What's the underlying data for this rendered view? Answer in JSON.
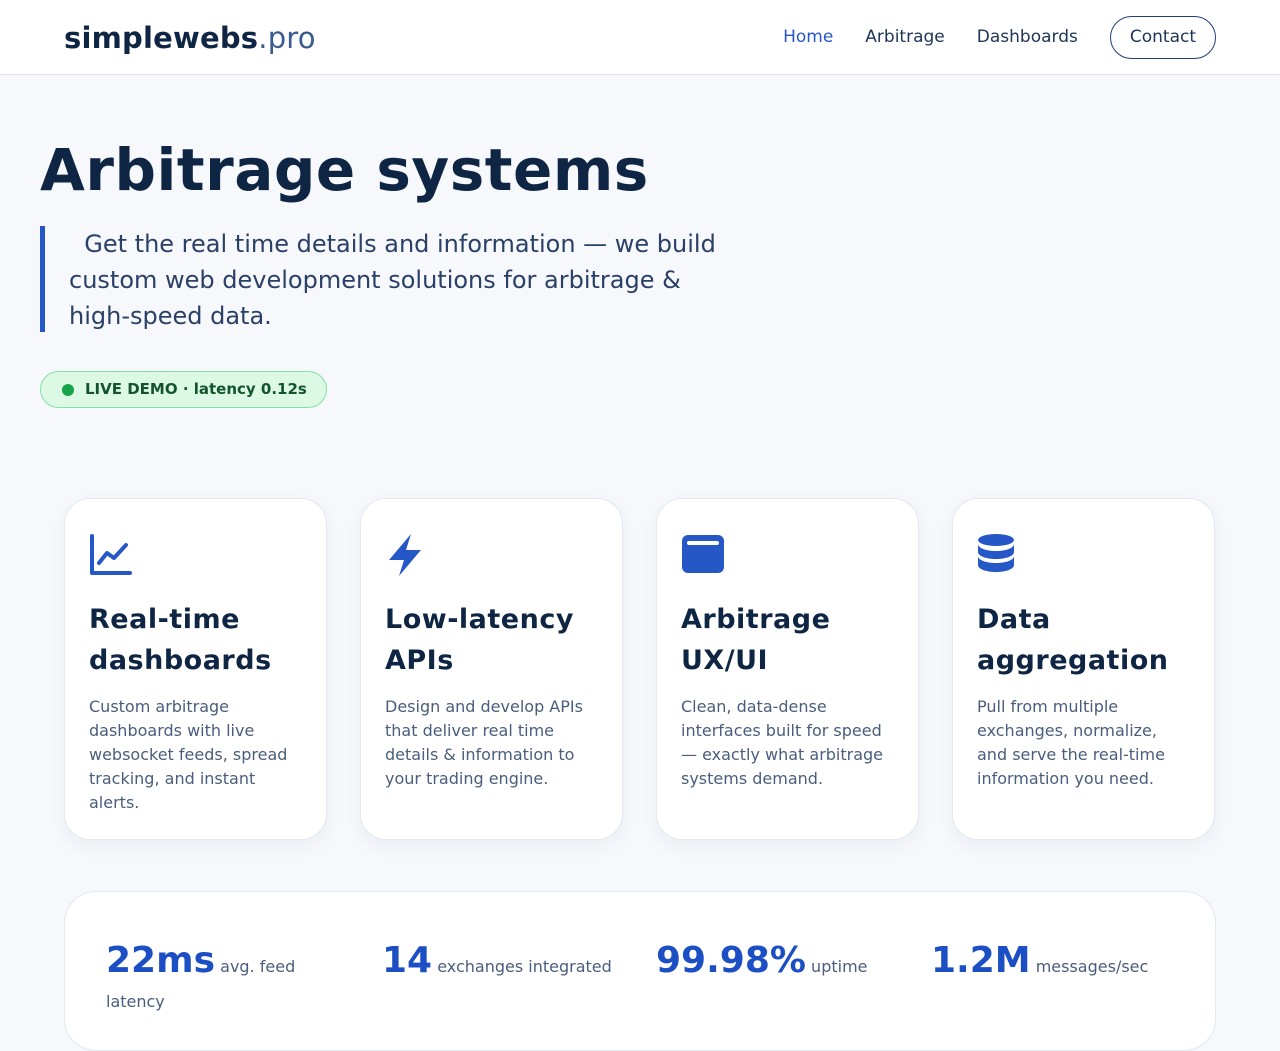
{
  "header": {
    "logo_bold": "simplewebs",
    "logo_light": ".pro",
    "nav": [
      "Home",
      "Arbitrage",
      "Dashboards"
    ],
    "contact_label": "Contact"
  },
  "hero": {
    "title": "Arbitrage systems",
    "quote": "Get the real time details and information — we build custom web development solutions for arbitrage & high-speed data.",
    "badge": "LIVE DEMO · latency 0.12s"
  },
  "cards": [
    {
      "icon": "line-chart-icon",
      "title": "Real-time dashboards",
      "text": "Custom arbitrage dashboards with live websocket feeds, spread tracking, and instant alerts."
    },
    {
      "icon": "lightning-icon",
      "title": "Low-latency APIs",
      "text": "Design and develop APIs that deliver real time details & information to your trading engine."
    },
    {
      "icon": "window-icon",
      "title": "Arbitrage UX/UI",
      "text": "Clean, data-dense interfaces built for speed — exactly what arbitrage systems demand."
    },
    {
      "icon": "database-icon",
      "title": "Data aggregation",
      "text": "Pull from multiple exchanges, normalize, and serve the real-time information you need."
    }
  ],
  "stats": [
    {
      "value": "22ms",
      "label": "avg. feed latency"
    },
    {
      "value": "14",
      "label": "exchanges integrated"
    },
    {
      "value": "99.98%",
      "label": "uptime"
    },
    {
      "value": "1.2M",
      "label": "messages/sec"
    }
  ],
  "colors": {
    "accent": "#2557c7",
    "heading": "#0f2544",
    "badge_green": "#16a34a"
  }
}
